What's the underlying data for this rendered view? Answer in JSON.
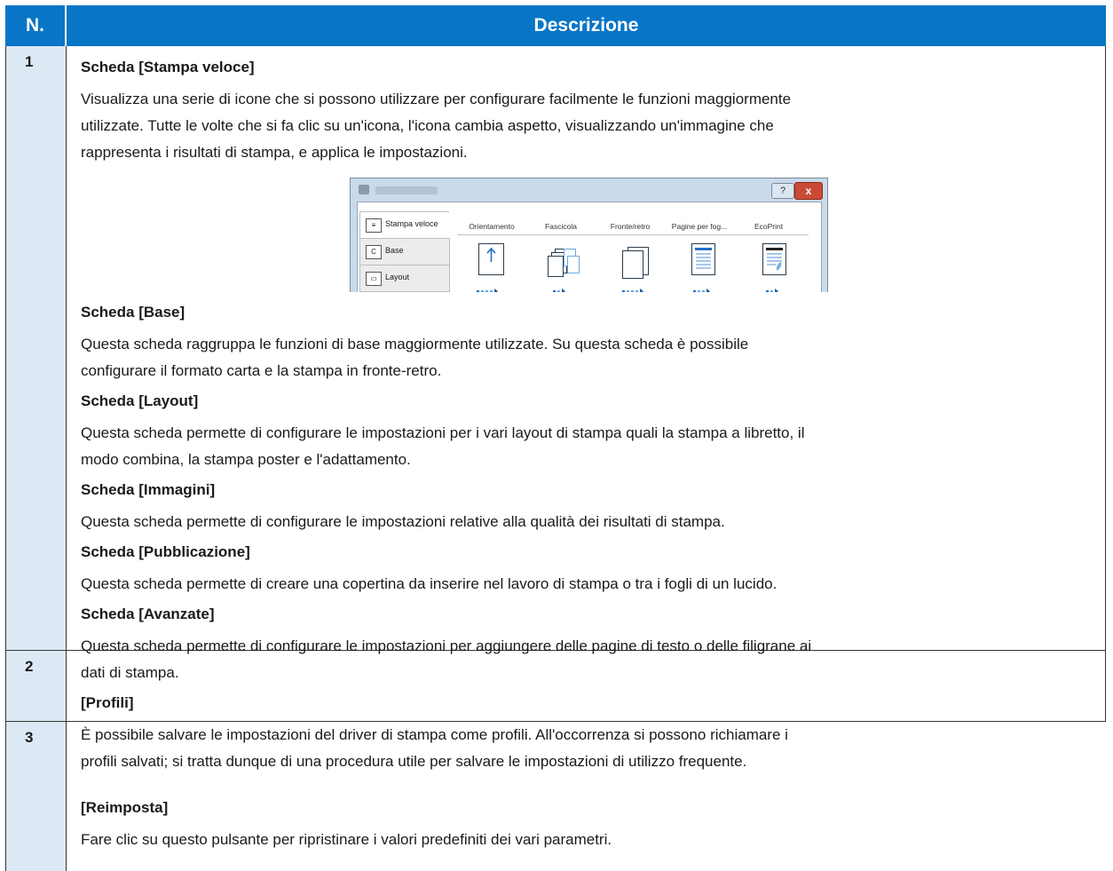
{
  "header": {
    "col_num": "N.",
    "col_desc": "Descrizione"
  },
  "rows": [
    {
      "num": "1",
      "blocks": [
        {
          "heading": "Scheda [Stampa veloce]",
          "lines": [
            "Visualizza una serie di icone che si possono utilizzare per configurare facilmente le funzioni maggiormente",
            "utilizzate. Tutte le volte che si fa clic su un'icona, l'icona cambia aspetto, visualizzando un'immagine che",
            "rappresenta i risultati di stampa, e applica le impostazioni."
          ]
        },
        {
          "heading": "Scheda [Base]",
          "lines": [
            "Questa scheda raggruppa le funzioni di base maggiormente utilizzate. Su questa scheda è possibile",
            "configurare il formato carta e la stampa in fronte-retro."
          ]
        },
        {
          "heading": "Scheda [Layout]",
          "lines": [
            "Questa scheda permette di configurare le impostazioni per i vari layout di stampa quali la stampa a libretto, il",
            "modo combina, la stampa poster e l'adattamento."
          ]
        },
        {
          "heading": "Scheda [Immagini]",
          "lines": [
            "Questa scheda permette di configurare le impostazioni relative alla qualità dei risultati di stampa."
          ]
        },
        {
          "heading": "Scheda [Pubblicazione]",
          "lines": [
            "Questa scheda permette di creare una copertina da inserire nel lavoro di stampa o tra i fogli di un lucido."
          ]
        },
        {
          "heading": "Scheda [Avanzate]",
          "lines": [
            "Questa scheda permette di configurare le impostazioni per aggiungere delle pagine di testo o delle filigrane ai",
            "dati di stampa."
          ]
        }
      ]
    },
    {
      "num": "2",
      "blocks": [
        {
          "heading": "[Profili]",
          "lines": [
            "È possibile salvare le impostazioni del driver di stampa come profili. All'occorrenza si possono richiamare i",
            "profili salvati; si tratta dunque di una procedura utile per salvare le impostazioni di utilizzo frequente."
          ]
        }
      ]
    },
    {
      "num": "3",
      "blocks": [
        {
          "heading": "[Reimposta]",
          "lines": [
            "Fare clic su questo pulsante per ripristinare i valori predefiniti dei vari parametri."
          ]
        }
      ]
    }
  ],
  "screenshot": {
    "help_glyph": "?",
    "close_glyph": "x",
    "tabs": [
      "Stampa veloce",
      "Base",
      "Layout"
    ],
    "columns": [
      "Orientamento",
      "Fascicola",
      "Fronte/retro",
      "Pagine per fog...",
      "EcoPrint"
    ],
    "colors": {
      "header_bg": "#0875c6",
      "num_col_bg": "#dce8f4",
      "titlebar": "#c9daea",
      "close_button": "#cb4a35"
    }
  }
}
